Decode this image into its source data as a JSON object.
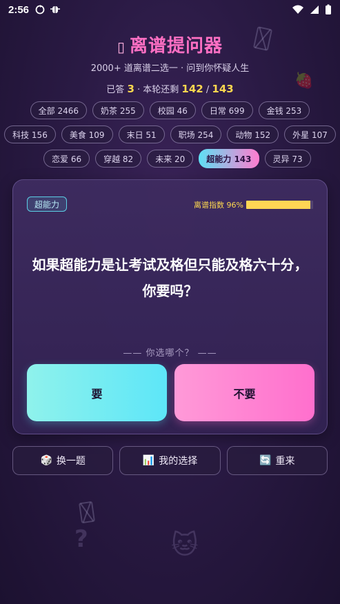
{
  "status_bar": {
    "time": "2:56"
  },
  "header": {
    "title": "离谱提问器",
    "title_icon": "▯",
    "subtitle": "2000+ 道离谱二选一 · 问到你怀疑人生"
  },
  "stats": {
    "answered_label": "已答",
    "answered": "3",
    "remaining_label": "· 本轮还剩",
    "remaining": "142",
    "separator": "/",
    "total": "143"
  },
  "categories": [
    {
      "label": "全部 2466"
    },
    {
      "label": "奶茶 255"
    },
    {
      "label": "校园 46"
    },
    {
      "label": "日常 699"
    },
    {
      "label": "金钱 253"
    },
    {
      "label": "科技 156"
    },
    {
      "label": "美食 109"
    },
    {
      "label": "末日 51"
    },
    {
      "label": "职场 254"
    },
    {
      "label": "动物 152"
    },
    {
      "label": "外星 107"
    },
    {
      "label": "恋爱 66"
    },
    {
      "label": "穿越 82"
    },
    {
      "label": "未来 20"
    },
    {
      "label": "超能力 143",
      "active": true
    },
    {
      "label": "灵异 73"
    }
  ],
  "card": {
    "tag": "超能力",
    "index_label": "离谱指数 96%",
    "index_value": 0.96,
    "question": "如果超能力是让考试及格但只能及格六十分，你要吗？",
    "hint": "—— 你选哪个？ ——",
    "option_a": "要",
    "option_b": "不要"
  },
  "actions": {
    "next": "换一题",
    "my_choices": "我的选择",
    "restart": "重来"
  },
  "colors": {
    "accent_pink": "#ff6fc3",
    "accent_yellow": "#ffd84f",
    "accent_cyan": "#5de6f8"
  }
}
